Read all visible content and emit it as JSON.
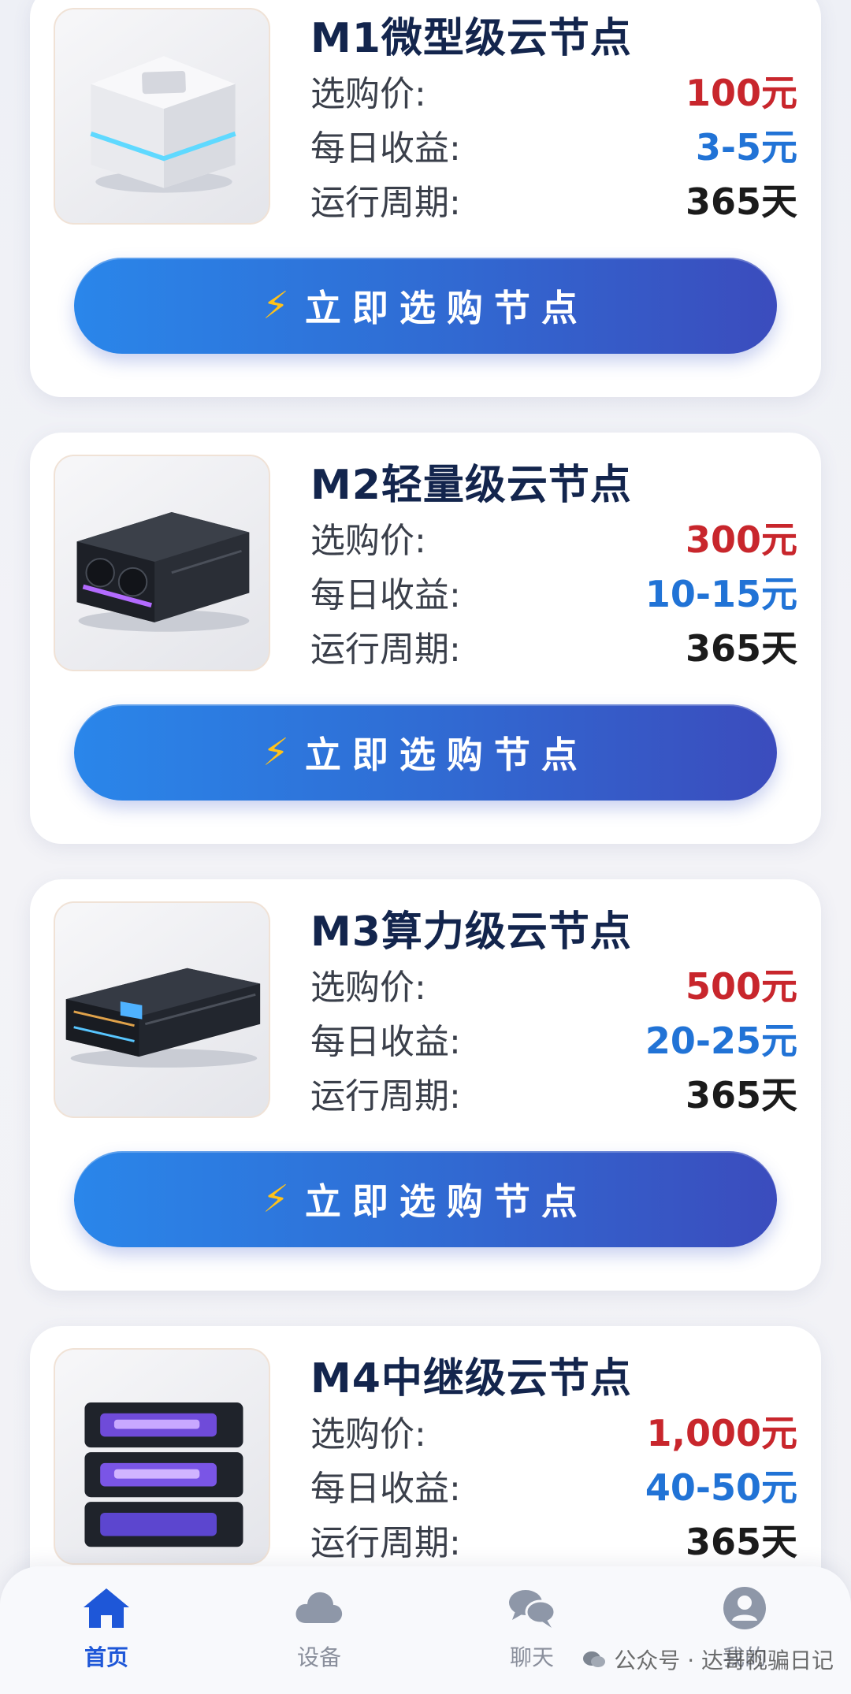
{
  "labels": {
    "price": "选购价:",
    "earnings": "每日收益:",
    "cycle": "运行周期:"
  },
  "button": {
    "icon": "⚡",
    "label": "立即选购节点"
  },
  "nodes": [
    {
      "name": "M1微型级云节点",
      "price": "100元",
      "earnings": "3-5元",
      "cycle": "365天",
      "image_icon": "mini-cube-device-icon"
    },
    {
      "name": "M2轻量级云节点",
      "price": "300元",
      "earnings": "10-15元",
      "cycle": "365天",
      "image_icon": "desktop-server-icon"
    },
    {
      "name": "M3算力级云节点",
      "price": "500元",
      "earnings": "20-25元",
      "cycle": "365天",
      "image_icon": "rack-server-icon"
    },
    {
      "name": "M4中继级云节点",
      "price": "1,000元",
      "earnings": "40-50元",
      "cycle": "365天",
      "image_icon": "stacked-server-icon"
    }
  ],
  "tabs": [
    {
      "label": "首页",
      "icon": "home-icon",
      "active": true
    },
    {
      "label": "设备",
      "icon": "cloud-icon",
      "active": false
    },
    {
      "label": "聊天",
      "icon": "chat-bubbles-icon",
      "active": false
    },
    {
      "label": "我的",
      "icon": "user-icon",
      "active": false
    }
  ],
  "watermark": "公众号 · 达哥视骗日记",
  "colors": {
    "price": "#c8262c",
    "earnings": "#2173d6",
    "title": "#13254d",
    "button_start": "#2a86ea",
    "button_end": "#3b4cbd",
    "tab_active": "#1e57d8",
    "tab_inactive": "#8a8f9c"
  }
}
